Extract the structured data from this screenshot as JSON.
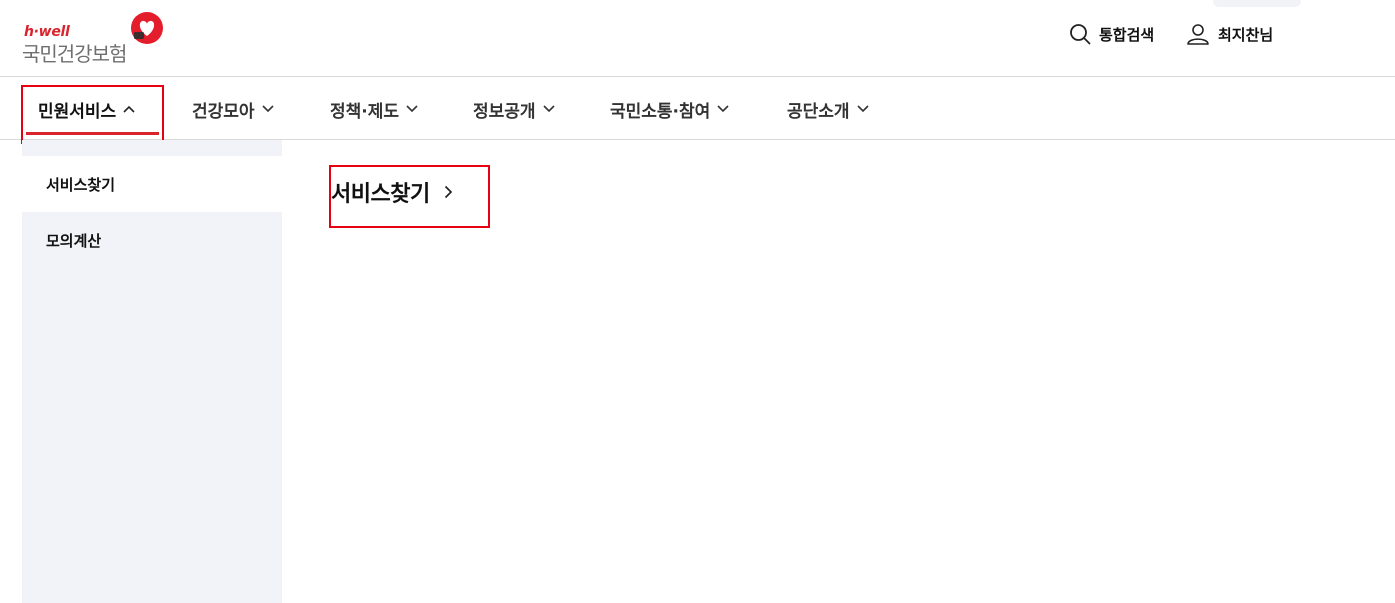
{
  "header": {
    "logo": {
      "tagline": "h·well",
      "name": "국민건강보험"
    },
    "utility": {
      "search_label": "통합검색",
      "user_label": "최지찬님"
    }
  },
  "gnb": {
    "items": [
      {
        "label": "민원서비스",
        "state": "expanded"
      },
      {
        "label": "건강모아",
        "state": "collapsed"
      },
      {
        "label": "정책·제도",
        "state": "collapsed"
      },
      {
        "label": "정보공개",
        "state": "collapsed"
      },
      {
        "label": "국민소통·참여",
        "state": "collapsed"
      },
      {
        "label": "공단소개",
        "state": "collapsed"
      }
    ]
  },
  "sidebar": {
    "items": [
      {
        "label": "서비스찾기",
        "selected": true
      },
      {
        "label": "모의계산",
        "selected": false
      }
    ]
  },
  "main": {
    "title": "서비스찾기"
  },
  "colors": {
    "accent": "#d9232d",
    "highlight_box": "#e60012",
    "sidebar_bg": "#f2f3f8",
    "divider": "#d9d9d9"
  },
  "icons": {
    "search": "search-icon",
    "user": "user-icon",
    "expand": "chevron-down-icon",
    "collapse": "chevron-up-icon",
    "forward": "chevron-right-icon"
  }
}
